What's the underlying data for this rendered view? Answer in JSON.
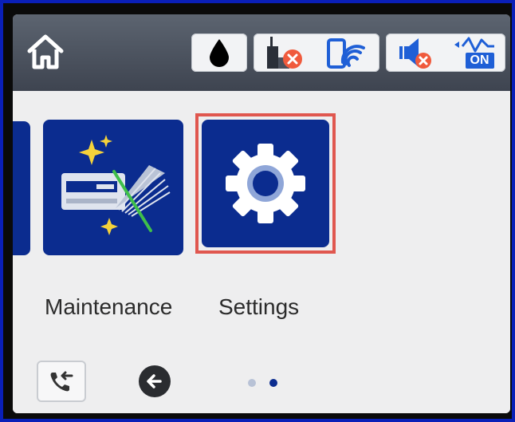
{
  "tiles": [
    {
      "name": "Maintenance",
      "label": "Maintenance",
      "icon": "maintenance-icon"
    },
    {
      "name": "Settings",
      "label": "Settings",
      "icon": "gear-icon",
      "selected": true
    }
  ],
  "status_bar": {
    "icons": [
      "home-icon",
      "ink-drop-icon",
      "fax-line-error-icon",
      "wifi-direct-icon",
      "sound-muted-icon",
      "power-saving-on-icon"
    ],
    "power_badge": "ON"
  },
  "pagination": {
    "pages": 2,
    "current": 2
  },
  "colors": {
    "tile_blue": "#0b2c8f",
    "selection": "#e0574f",
    "topbar": "#4a505c",
    "error": "#f05a3c"
  }
}
